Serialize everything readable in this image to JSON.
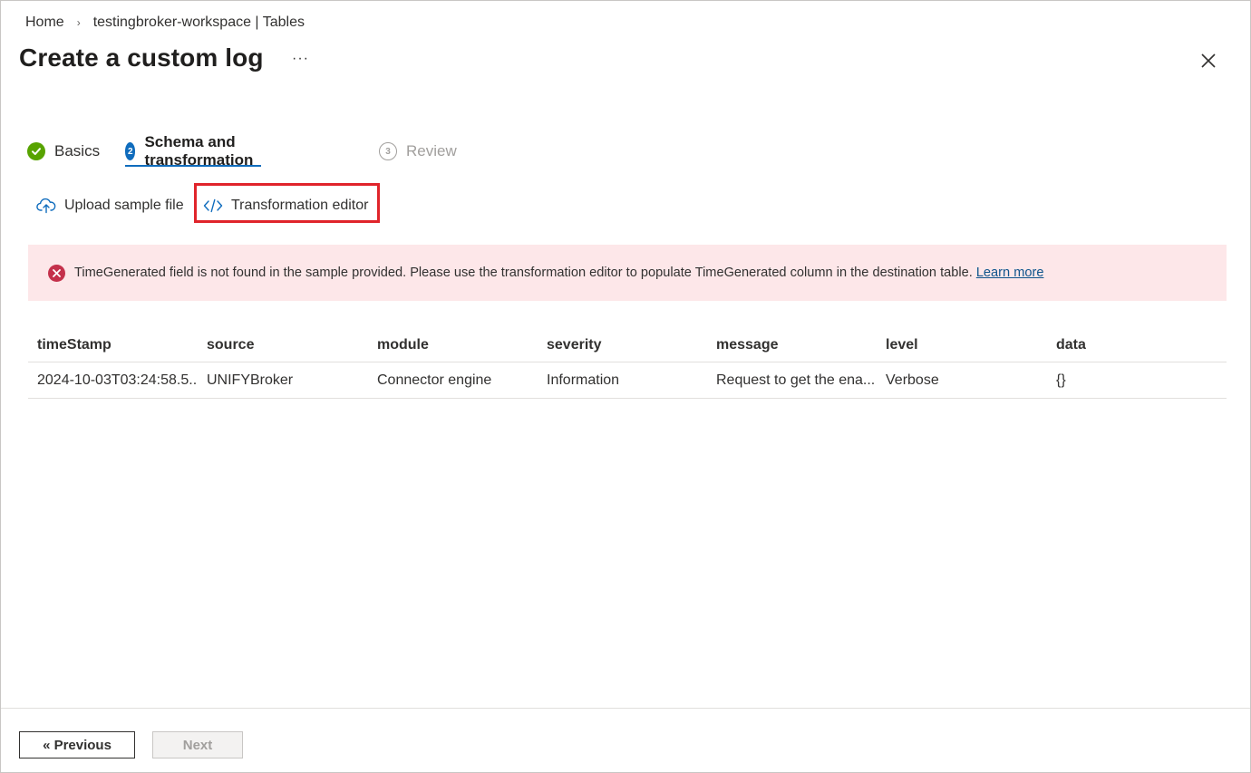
{
  "breadcrumb": {
    "home": "Home",
    "workspace": "testingbroker-workspace | Tables",
    "separator": "›"
  },
  "page": {
    "title": "Create a custom log",
    "more": "···"
  },
  "steps": [
    {
      "label": "Basics",
      "badge": "",
      "state": "completed"
    },
    {
      "label": "Schema and transformation",
      "badge": "2",
      "state": "active"
    },
    {
      "label": "Review",
      "badge": "3",
      "state": "disabled"
    }
  ],
  "toolbar": {
    "upload_label": "Upload sample file",
    "editor_label": "Transformation editor"
  },
  "error": {
    "message": "TimeGenerated field is not found in the sample provided. Please use the transformation editor to populate TimeGenerated column in the destination table.",
    "link": "Learn more"
  },
  "table": {
    "columns": [
      "timeStamp",
      "source",
      "module",
      "severity",
      "message",
      "level",
      "data"
    ],
    "rows": [
      [
        "2024-10-03T03:24:58.5...",
        "UNIFYBroker",
        "Connector engine",
        "Information",
        "Request to get the ena...",
        "Verbose",
        "{}"
      ]
    ]
  },
  "footer": {
    "previous_label": "« Previous",
    "next_label": "Next"
  },
  "colors": {
    "accent": "#0f6cbd",
    "success": "#57a300",
    "error": "#c4314b",
    "error_bg": "#fde7e9",
    "highlight": "#e0242b"
  },
  "icons": {
    "step1": "checkmark-circle-icon",
    "upload": "cloud-upload-icon",
    "editor": "code-icon",
    "error": "error-circle-icon",
    "close": "close-icon"
  }
}
